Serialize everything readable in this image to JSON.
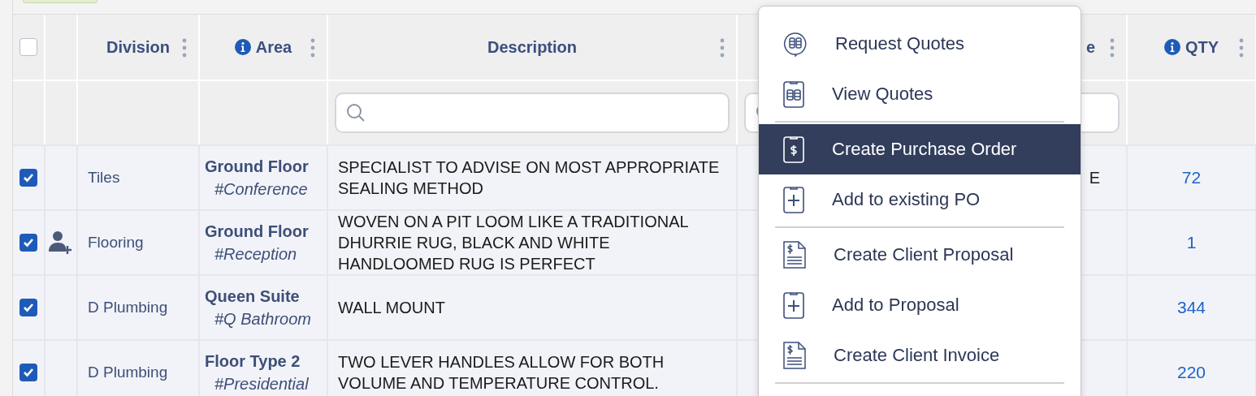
{
  "header": {
    "select_all": {
      "checked": false
    },
    "columns": [
      {
        "label": "Division",
        "info": false,
        "filter": false
      },
      {
        "label": "Area",
        "info": true,
        "filter": false
      },
      {
        "label": "Description",
        "info": false,
        "filter": true
      },
      {
        "label": "e",
        "info": false,
        "filter": true
      },
      {
        "label": "QTY",
        "info": true,
        "filter": false
      }
    ]
  },
  "rows": [
    {
      "checked": true,
      "assign_icon": false,
      "division": "Tiles",
      "area": "Ground Floor",
      "area_tag": "#Conference",
      "description": "SPECIALIST TO ADVISE ON MOST APPROPRIATE SEALING METHOD",
      "column_6": "E",
      "qty": "72"
    },
    {
      "checked": true,
      "assign_icon": true,
      "division": "Flooring",
      "area": "Ground Floor",
      "area_tag": "#Reception",
      "description": "WOVEN ON A PIT LOOM LIKE A TRADITIONAL DHURRIE RUG, BLACK AND WHITE HANDLOOMED RUG IS PERFECT",
      "qty": "1"
    },
    {
      "checked": true,
      "assign_icon": false,
      "division": "D Plumbing",
      "area": "Queen Suite",
      "area_tag": "#Q Bathroom",
      "description": "WALL MOUNT",
      "qty": "344"
    },
    {
      "checked": true,
      "assign_icon": false,
      "division": "D Plumbing",
      "area": "Floor Type 2",
      "area_tag": "#Presidential",
      "description": "TWO LEVER HANDLES ALLOW FOR BOTH VOLUME AND TEMPERATURE CONTROL.",
      "qty": "220"
    }
  ],
  "context_menu": [
    {
      "kind": "bubble",
      "label": "Request Quotes",
      "selected": false
    },
    {
      "kind": "clipboard",
      "label": "View Quotes",
      "selected": false
    },
    {
      "kind": "separator"
    },
    {
      "kind": "order",
      "label": "Create Purchase Order",
      "selected": true
    },
    {
      "kind": "add",
      "label": "Add to existing PO",
      "selected": false
    },
    {
      "kind": "separator"
    },
    {
      "kind": "document",
      "label": "Create Client Proposal",
      "selected": false
    },
    {
      "kind": "add",
      "label": "Add to Proposal",
      "selected": false
    },
    {
      "kind": "document",
      "label": "Create Client Invoice",
      "selected": false
    },
    {
      "kind": "separator"
    }
  ]
}
